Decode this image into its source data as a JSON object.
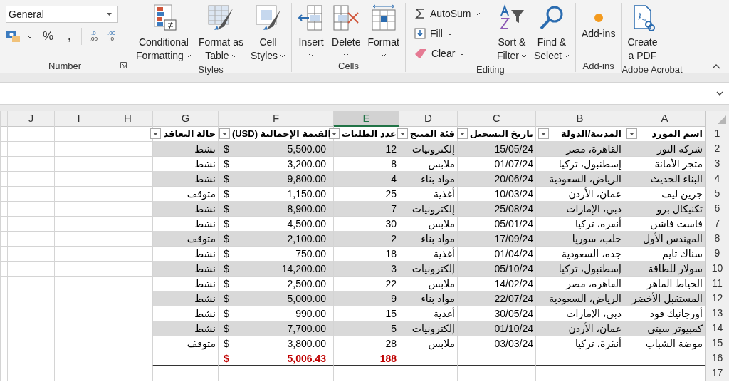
{
  "ribbon": {
    "number": {
      "label": "Number",
      "format": "General",
      "percent": "%",
      "comma": ",",
      "increase_decimal": {
        "top": ".0",
        "bottom": ".00"
      },
      "decrease_decimal": {
        "top": ".00",
        "bottom": ".0"
      }
    },
    "styles": {
      "label": "Styles",
      "conditional_formatting": {
        "lines": [
          "Conditional",
          "Formatting"
        ],
        "dropdown": true
      },
      "format_as_table": {
        "lines": [
          "Format as",
          "Table"
        ],
        "dropdown": true
      },
      "cell_styles": {
        "lines": [
          "Cell",
          "Styles"
        ],
        "dropdown": true
      }
    },
    "cells": {
      "label": "Cells",
      "insert": {
        "lines": [
          "Insert"
        ],
        "dropdown": true
      },
      "delete": {
        "lines": [
          "Delete"
        ],
        "dropdown": true
      },
      "format": {
        "lines": [
          "Format"
        ],
        "dropdown": true
      }
    },
    "editing": {
      "label": "Editing",
      "small": [
        {
          "label": "AutoSum",
          "dropdown": true
        },
        {
          "label": "Fill",
          "dropdown": true
        },
        {
          "label": "Clear",
          "dropdown": true
        }
      ],
      "sort_filter": {
        "lines": [
          "Sort &",
          "Filter"
        ],
        "dropdown": true
      },
      "find_select": {
        "lines": [
          "Find &",
          "Select"
        ],
        "dropdown": true
      }
    },
    "add_ins": {
      "label": "Add-ins",
      "add_ins_button": {
        "lines": [
          "Add-ins"
        ]
      }
    },
    "adobe_acrobat": {
      "label": "Adobe Acrobat",
      "create_pdf": {
        "lines": [
          "Create",
          "a PDF"
        ]
      }
    }
  },
  "columns": [
    {
      "letter": "A",
      "selected": false
    },
    {
      "letter": "B",
      "selected": false
    },
    {
      "letter": "C",
      "selected": false
    },
    {
      "letter": "D",
      "selected": false
    },
    {
      "letter": "E",
      "selected": true
    },
    {
      "letter": "F",
      "selected": false
    },
    {
      "letter": "G",
      "selected": false
    },
    {
      "letter": "H",
      "selected": false
    },
    {
      "letter": "I",
      "selected": false
    },
    {
      "letter": "J",
      "selected": false
    }
  ],
  "header": {
    "num": "1",
    "cells": [
      "اسم المورد",
      "المدينة/الدولة",
      "تاريخ التسجيل",
      "فئة المنتج",
      "عدد الطلبات",
      "القيمة الإجمالية (USD)",
      "حالة التعاقد"
    ]
  },
  "rows": [
    {
      "num": "2",
      "supplier": "شركة النور",
      "city": "القاهرة، مصر",
      "date": "15/05/24",
      "category": "إلكترونيات",
      "orders": "12",
      "currency": "$",
      "amount": "5,500.00",
      "status": "نشط"
    },
    {
      "num": "3",
      "supplier": "متجر الأمانة",
      "city": "إسطنبول، تركيا",
      "date": "01/07/24",
      "category": "ملابس",
      "orders": "8",
      "currency": "$",
      "amount": "3,200.00",
      "status": "نشط"
    },
    {
      "num": "4",
      "supplier": "البناء الحديث",
      "city": "الرياض، السعودية",
      "date": "20/06/24",
      "category": "مواد بناء",
      "orders": "4",
      "currency": "$",
      "amount": "9,800.00",
      "status": "نشط"
    },
    {
      "num": "5",
      "supplier": "جرين ليف",
      "city": "عمان، الأردن",
      "date": "10/03/24",
      "category": "أغذية",
      "orders": "25",
      "currency": "$",
      "amount": "1,150.00",
      "status": "متوقف"
    },
    {
      "num": "6",
      "supplier": "تكنيكال برو",
      "city": "دبي، الإمارات",
      "date": "25/08/24",
      "category": "إلكترونيات",
      "orders": "7",
      "currency": "$",
      "amount": "8,900.00",
      "status": "نشط"
    },
    {
      "num": "7",
      "supplier": "فاست فاشن",
      "city": "أنقرة، تركيا",
      "date": "05/01/24",
      "category": "ملابس",
      "orders": "30",
      "currency": "$",
      "amount": "4,500.00",
      "status": "نشط"
    },
    {
      "num": "8",
      "supplier": "المهندس الأول",
      "city": "حلب، سوريا",
      "date": "17/09/24",
      "category": "مواد بناء",
      "orders": "2",
      "currency": "$",
      "amount": "2,100.00",
      "status": "متوقف"
    },
    {
      "num": "9",
      "supplier": "سناك تايم",
      "city": "جدة، السعودية",
      "date": "01/04/24",
      "category": "أغذية",
      "orders": "18",
      "currency": "$",
      "amount": "750.00",
      "status": "نشط"
    },
    {
      "num": "10",
      "supplier": "سولار للطاقة",
      "city": "إسطنبول، تركيا",
      "date": "05/10/24",
      "category": "إلكترونيات",
      "orders": "3",
      "currency": "$",
      "amount": "14,200.00",
      "status": "نشط"
    },
    {
      "num": "11",
      "supplier": "الخياط الماهر",
      "city": "القاهرة، مصر",
      "date": "14/02/24",
      "category": "ملابس",
      "orders": "22",
      "currency": "$",
      "amount": "2,500.00",
      "status": "نشط"
    },
    {
      "num": "12",
      "supplier": "المستقبل الأخضر",
      "city": "الرياض، السعودية",
      "date": "22/07/24",
      "category": "مواد بناء",
      "orders": "9",
      "currency": "$",
      "amount": "5,000.00",
      "status": "نشط"
    },
    {
      "num": "13",
      "supplier": "أورجانيك فود",
      "city": "دبي، الإمارات",
      "date": "30/05/24",
      "category": "أغذية",
      "orders": "15",
      "currency": "$",
      "amount": "990.00",
      "status": "نشط"
    },
    {
      "num": "14",
      "supplier": "كمبيوتر سيتي",
      "city": "عمان، الأردن",
      "date": "01/10/24",
      "category": "إلكترونيات",
      "orders": "5",
      "currency": "$",
      "amount": "7,700.00",
      "status": "نشط"
    },
    {
      "num": "15",
      "supplier": "موضة الشباب",
      "city": "أنقرة، تركيا",
      "date": "03/03/24",
      "category": "ملابس",
      "orders": "28",
      "currency": "$",
      "amount": "3,800.00",
      "status": "متوقف"
    }
  ],
  "total": {
    "num": "16",
    "orders": "188",
    "currency": "$",
    "amount": "5,006.43"
  },
  "empty_rows": [
    "17"
  ]
}
